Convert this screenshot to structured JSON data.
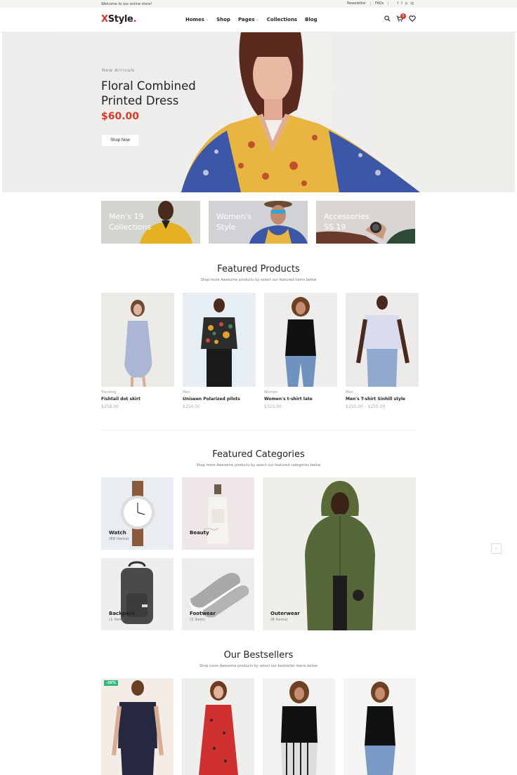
{
  "topbar": {
    "welcome": "Welcome to our online store!",
    "newsletter": "Newsletter",
    "faqs": "FAQs",
    "socials": [
      "f",
      "t",
      "p",
      "ig"
    ]
  },
  "header": {
    "logo_x": "X",
    "logo_rest": "Style",
    "logo_dot": ".",
    "nav": [
      "Homes",
      "Shop",
      "Pages",
      "Collections",
      "Blog"
    ],
    "cart_count": "0"
  },
  "hero": {
    "eyebrow": "New Arrivals",
    "title_line1": "Floral Combined",
    "title_line2": "Printed Dress",
    "price": "$60.00",
    "button": "Shop Now"
  },
  "banners": [
    {
      "line1": "Men's 19",
      "line2": "Collections"
    },
    {
      "line1": "Women's",
      "line2": "Style"
    },
    {
      "line1": "Accessories",
      "line2": "SS 19"
    }
  ],
  "featured_products": {
    "title": "Featured Products",
    "subtitle": "Shop more Awesome products by select our featured items below",
    "items": [
      {
        "category": "Trending",
        "name": "Fishtail dot skirt",
        "price": "$258.00"
      },
      {
        "category": "Men",
        "name": "Uniseen Polarized pilots",
        "price": "$254.00"
      },
      {
        "category": "Women",
        "name": "Women's t-shirt late",
        "price": "$325.00"
      },
      {
        "category": "Men",
        "name": "Men's T-shirt Sinhill style",
        "price": "$255.00 – $255.00"
      }
    ]
  },
  "featured_categories": {
    "title": "Featured Categories",
    "subtitle": "Shop more Awesome products by select our featured categories below",
    "items": [
      {
        "name": "Watch",
        "count": "(68 items)"
      },
      {
        "name": "Beauty",
        "count": ""
      },
      {
        "name": "Backpack",
        "count": "(1 item)"
      },
      {
        "name": "Footwear",
        "count": "(1 item)"
      },
      {
        "name": "Outerwear",
        "count": "(8 items)"
      }
    ]
  },
  "bestsellers": {
    "title": "Our Bestsellers",
    "subtitle": "Shop more Awesome products by select our bestseller items below",
    "sale_badge": "-26%"
  },
  "side_button": "›",
  "colors": {
    "accent": "#d2392b",
    "sale": "#2db87a"
  }
}
